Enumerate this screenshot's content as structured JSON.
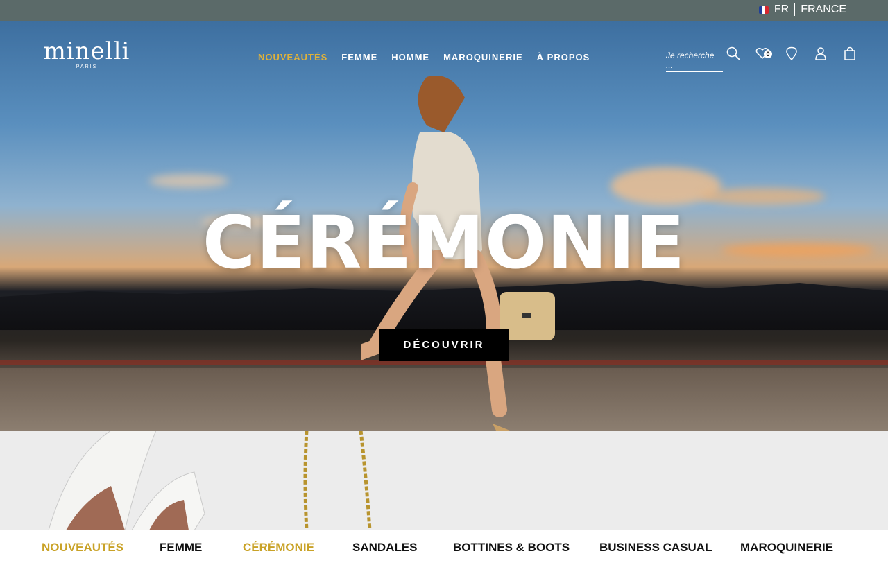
{
  "topbar": {
    "language": "FR",
    "country": "FRANCE"
  },
  "header": {
    "logo_name": "minelli",
    "logo_city": "PARIS",
    "nav": [
      {
        "label": "NOUVEAUTÉS",
        "active": true
      },
      {
        "label": "FEMME",
        "active": false
      },
      {
        "label": "HOMME",
        "active": false
      },
      {
        "label": "MAROQUINERIE",
        "active": false
      },
      {
        "label": "À PROPOS",
        "active": false
      }
    ],
    "search_placeholder": "Je recherche ...",
    "wishlist_count": "0",
    "icons": [
      "search-icon",
      "heart-icon",
      "location-pin-icon",
      "user-icon",
      "shopping-bag-icon"
    ]
  },
  "hero": {
    "headline": "CÉRÉMONIE",
    "cta_label": "DÉCOUVRIR"
  },
  "category_bar": [
    {
      "label": "NOUVEAUTÉS",
      "color": "#c9a227"
    },
    {
      "label": "FEMME",
      "color": "#111111"
    },
    {
      "label": "CÉRÉMONIE",
      "color": "#c9a227"
    },
    {
      "label": "SANDALES",
      "color": "#111111"
    },
    {
      "label": "BOTTINES & BOOTS",
      "color": "#111111"
    },
    {
      "label": "BUSINESS CASUAL",
      "color": "#111111"
    },
    {
      "label": "MAROQUINERIE",
      "color": "#111111"
    }
  ],
  "colors": {
    "accent_gold": "#e0b23a",
    "topbar": "#5b6a69"
  }
}
